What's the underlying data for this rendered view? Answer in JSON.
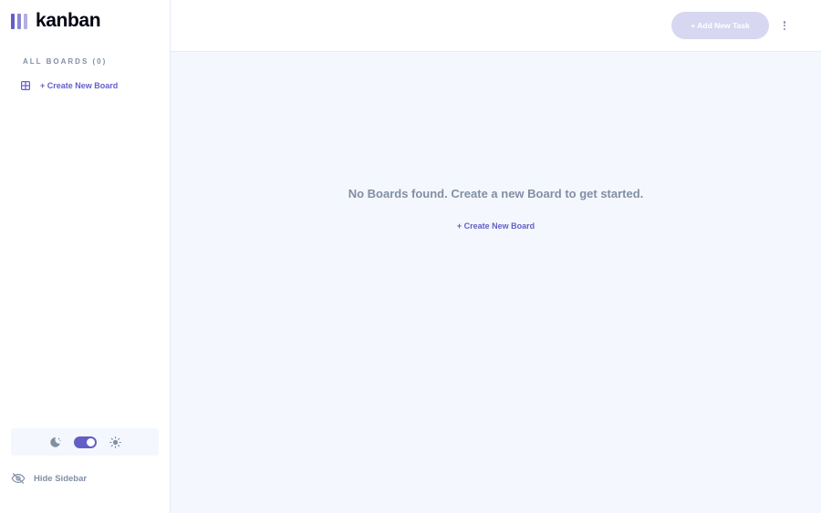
{
  "app": {
    "name": "kanban"
  },
  "sidebar": {
    "boards_heading": "ALL BOARDS (0)",
    "create_board_label": "+ Create New Board",
    "hide_sidebar_label": "Hide Sidebar",
    "theme_toggle": {
      "dark_mode": true
    }
  },
  "header": {
    "add_task_label": "+ Add New Task",
    "add_task_disabled": true
  },
  "main": {
    "empty_message": "No Boards found. Create a new Board to get started.",
    "create_board_label": "+ Create New Board"
  },
  "colors": {
    "accent": "#635fc7",
    "accent_disabled": "#d8d7f1",
    "muted_text": "#828fa3",
    "background": "#f4f7fd",
    "border": "#e4ebfa"
  },
  "icons": {
    "logo": "logo-bars-icon",
    "board": "board-icon",
    "moon": "moon-icon",
    "sun": "sun-icon",
    "hide": "eye-slash-icon",
    "more": "vertical-ellipsis-icon"
  }
}
